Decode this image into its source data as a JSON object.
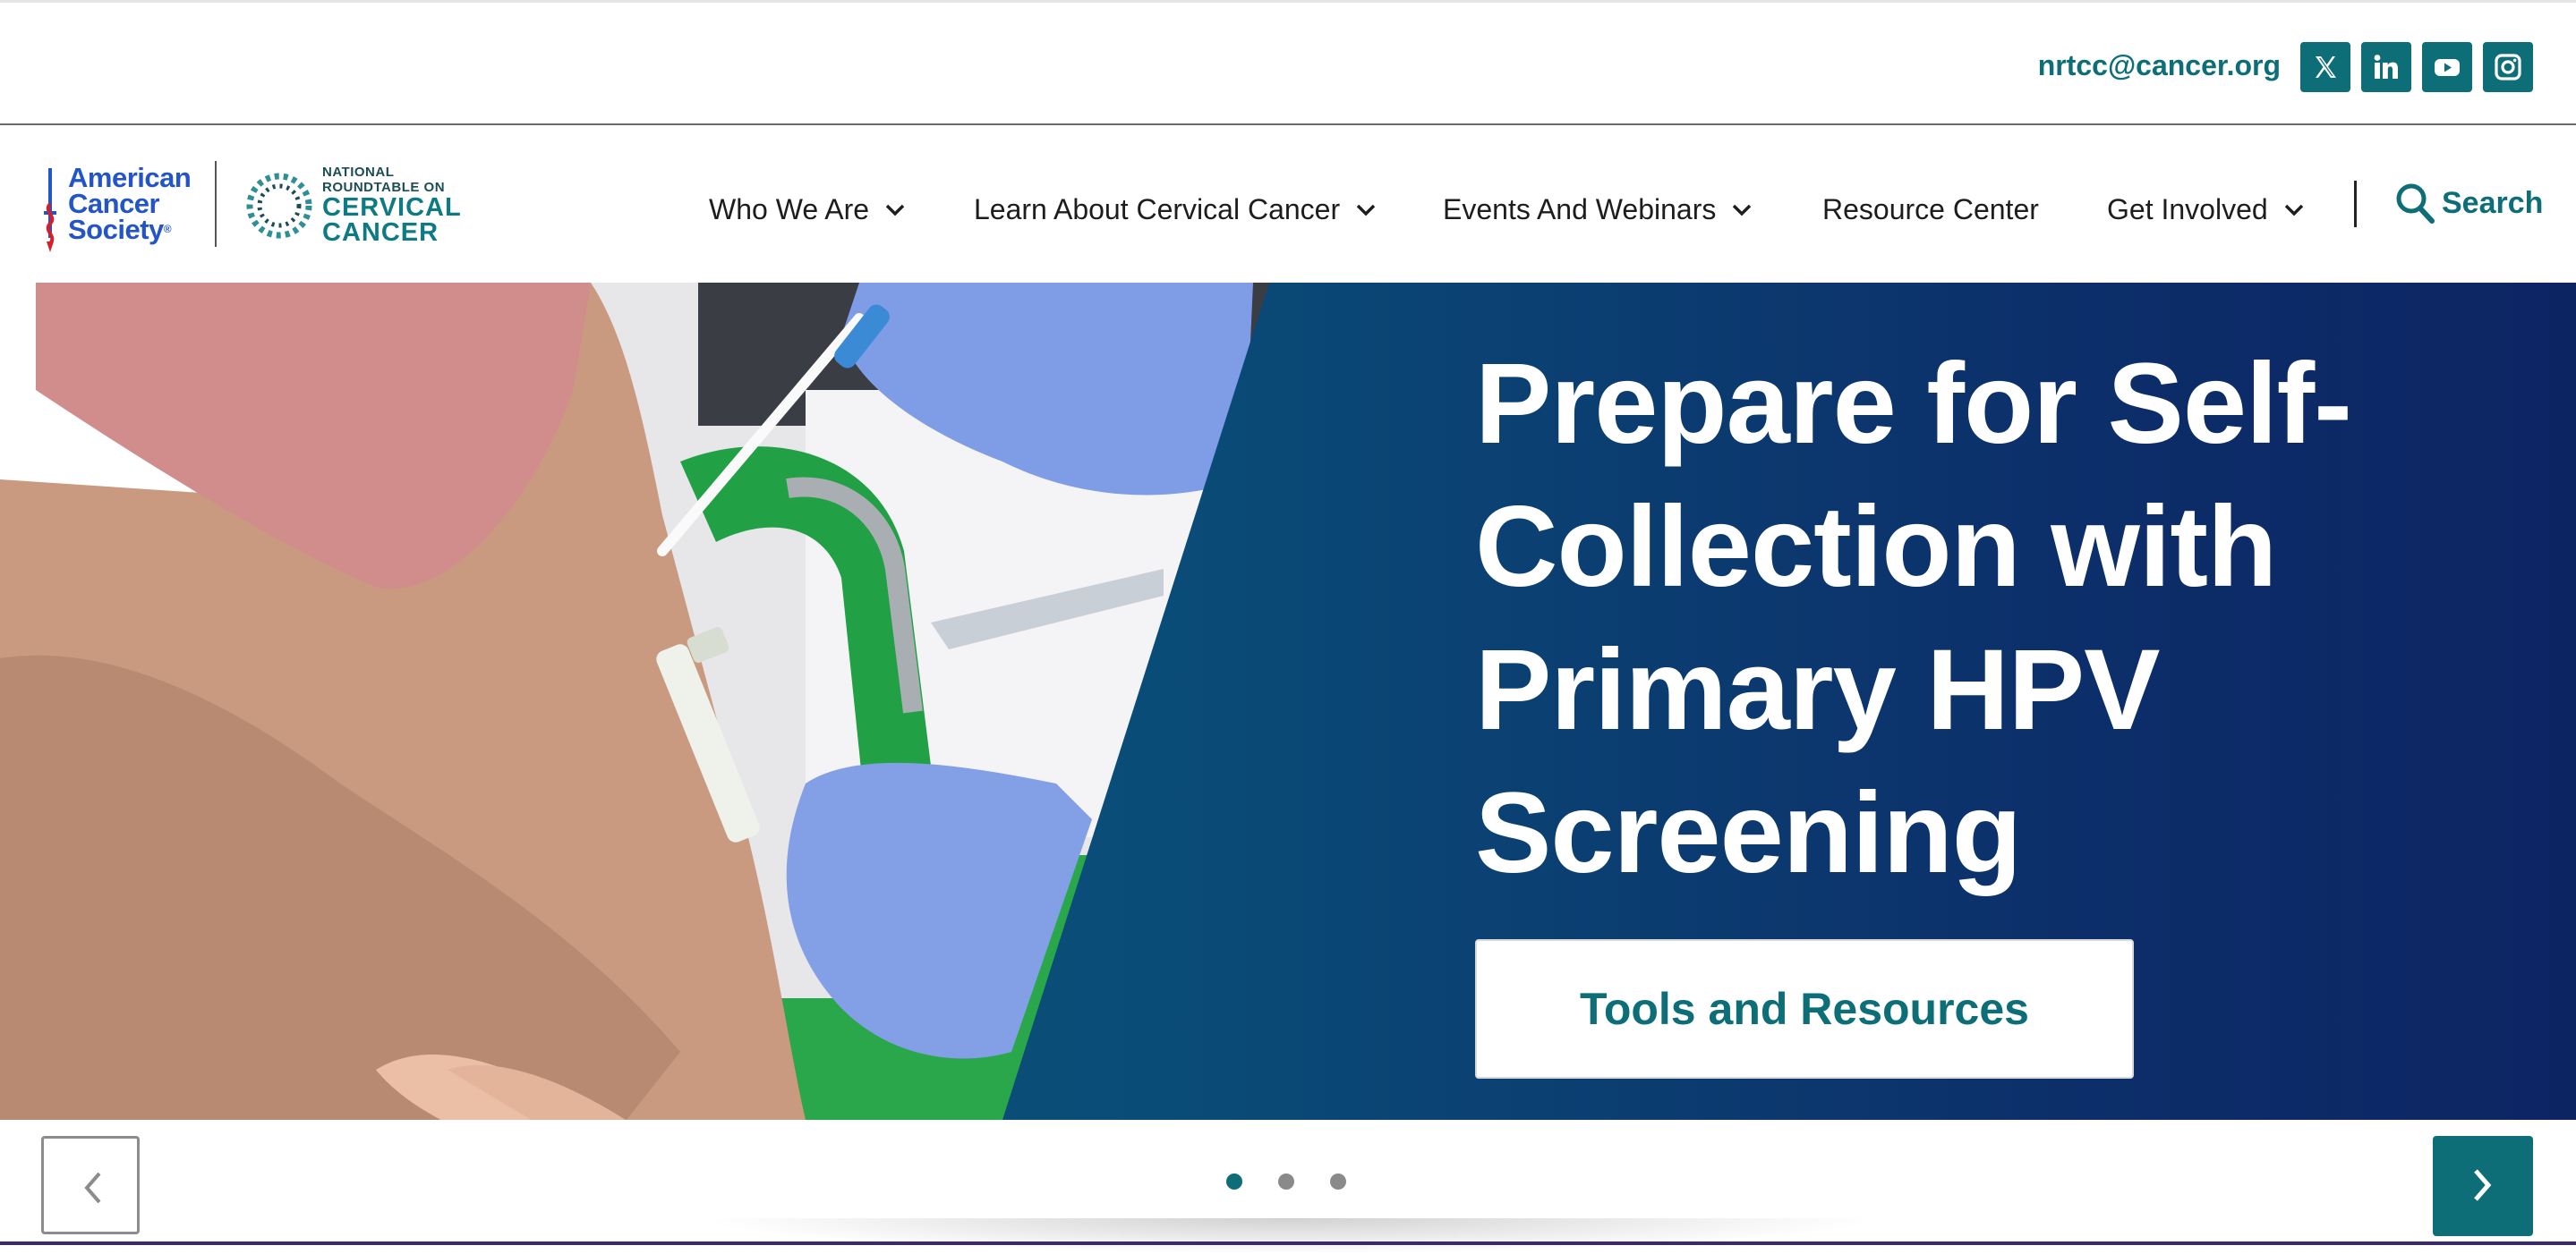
{
  "utility_bar": {
    "email": "nrtcc@cancer.org",
    "social_icons": [
      "x-icon",
      "linkedin-icon",
      "youtube-icon",
      "instagram-icon"
    ]
  },
  "header": {
    "acs_logo": {
      "line1": "American",
      "line2": "Cancer",
      "line3": "Society",
      "registered": "®"
    },
    "nrcc_logo": {
      "small1": "NATIONAL",
      "small2": "ROUNDTABLE ON",
      "big1": "CERVICAL",
      "big2": "CANCER"
    },
    "nav": [
      {
        "label": "Who We Are",
        "has_dropdown": true
      },
      {
        "label": "Learn About Cervical Cancer",
        "has_dropdown": true
      },
      {
        "label": "Events And Webinars",
        "has_dropdown": true
      },
      {
        "label": "Resource Center",
        "has_dropdown": false
      },
      {
        "label": "Get Involved",
        "has_dropdown": true
      }
    ],
    "search_label": "Search"
  },
  "hero": {
    "headline_lines": [
      "Prepare for Self-",
      "Collection with",
      "Primary HPV",
      "Screening"
    ],
    "cta_label": "Tools and Resources"
  },
  "carousel": {
    "slide_count": 3,
    "active_index": 0
  },
  "colors": {
    "brand_teal": "#0e6e78",
    "acs_blue": "#2455c8",
    "panel_dark": "#0d2463",
    "panel_light": "#0b5e7c"
  }
}
